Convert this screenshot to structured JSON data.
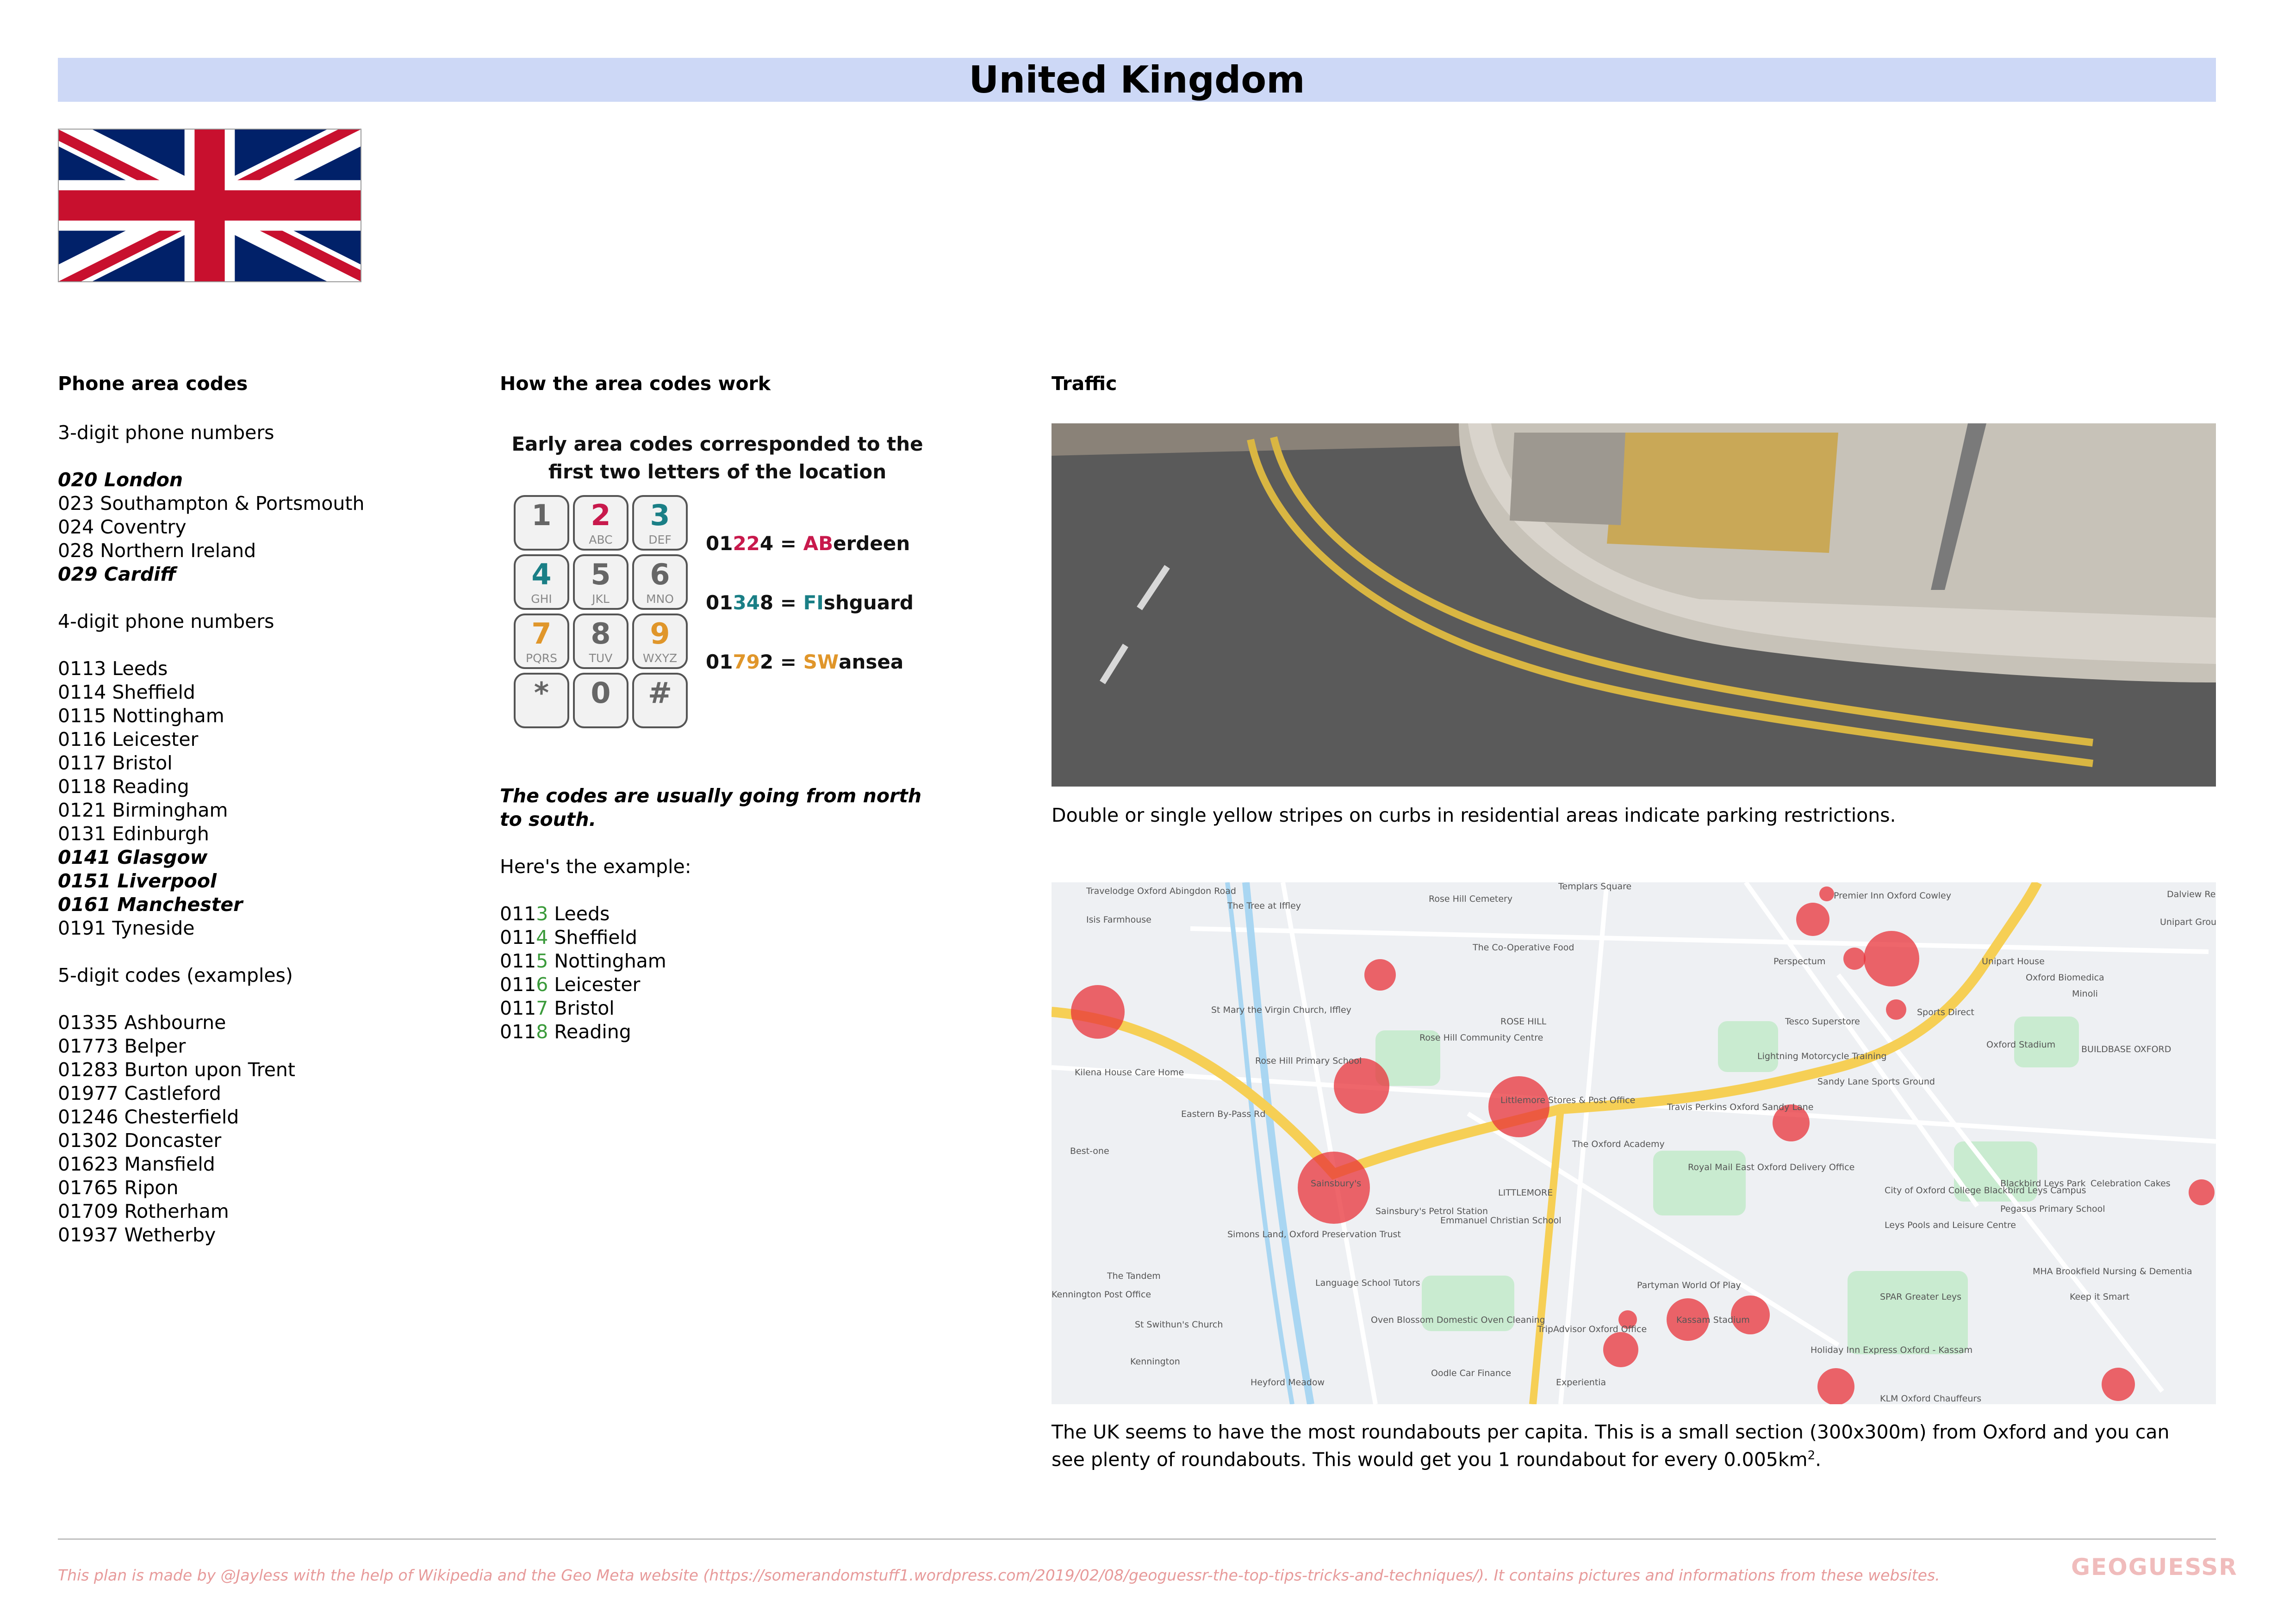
{
  "title": "United Kingdom",
  "phone": {
    "heading": "Phone area codes",
    "sub3": "3-digit phone numbers",
    "three_digit": [
      {
        "text": "020 London",
        "bold": true
      },
      {
        "text": "023 Southampton & Portsmouth",
        "bold": false
      },
      {
        "text": "024 Coventry",
        "bold": false
      },
      {
        "text": "028 Northern Ireland",
        "bold": false
      },
      {
        "text": "029 Cardiff",
        "bold": true
      }
    ],
    "sub4": "4-digit phone numbers",
    "four_digit": [
      {
        "text": "0113 Leeds",
        "bold": false
      },
      {
        "text": "0114 Sheffield",
        "bold": false
      },
      {
        "text": "0115 Nottingham",
        "bold": false
      },
      {
        "text": "0116 Leicester",
        "bold": false
      },
      {
        "text": "0117 Bristol",
        "bold": false
      },
      {
        "text": "0118 Reading",
        "bold": false
      },
      {
        "text": "0121 Birmingham",
        "bold": false
      },
      {
        "text": "0131 Edinburgh",
        "bold": false
      },
      {
        "text": "0141 Glasgow",
        "bold": true
      },
      {
        "text": "0151 Liverpool",
        "bold": true
      },
      {
        "text": "0161 Manchester",
        "bold": true
      },
      {
        "text": "0191 Tyneside",
        "bold": false
      }
    ],
    "sub5": "5-digit codes (examples)",
    "five_digit": [
      "01335 Ashbourne",
      "01773 Belper",
      "01283 Burton upon Trent",
      "01977 Castleford",
      "01246 Chesterfield",
      "01302 Doncaster",
      "01623 Mansfield",
      "01765 Ripon",
      "01709 Rotherham",
      "01937 Wetherby"
    ]
  },
  "howto": {
    "heading": "How the area codes work",
    "graphic_title_1": "Early area codes corresponded to the",
    "graphic_title_2": "first two letters of the location",
    "keys": [
      {
        "d": "1",
        "l": "",
        "color": "#666666"
      },
      {
        "d": "2",
        "l": "ABC",
        "color": "#c8194c"
      },
      {
        "d": "3",
        "l": "DEF",
        "color": "#1a7f86"
      },
      {
        "d": "4",
        "l": "GHI",
        "color": "#1a7f86"
      },
      {
        "d": "5",
        "l": "JKL",
        "color": "#666666"
      },
      {
        "d": "6",
        "l": "MNO",
        "color": "#666666"
      },
      {
        "d": "7",
        "l": "PQRS",
        "color": "#e0962a"
      },
      {
        "d": "8",
        "l": "TUV",
        "color": "#666666"
      },
      {
        "d": "9",
        "l": "WXYZ",
        "color": "#e0962a"
      },
      {
        "d": "*",
        "l": "",
        "color": "#666666"
      },
      {
        "d": "0",
        "l": "",
        "color": "#666666"
      },
      {
        "d": "#",
        "l": "",
        "color": "#666666"
      }
    ],
    "examples": [
      {
        "pre": "01",
        "hl": "22",
        "post": "4 = ",
        "hl2": "AB",
        "rest": "erdeen",
        "color": "#c8194c"
      },
      {
        "pre": "01",
        "hl": "34",
        "post": "8 = ",
        "hl2": "FI",
        "rest": "shguard",
        "color": "#1a7f86"
      },
      {
        "pre": "01",
        "hl": "79",
        "post": "2 = ",
        "hl2": "SW",
        "rest": "ansea",
        "color": "#e0962a"
      }
    ],
    "note": "The codes are usually going from north\nto south.",
    "example_intro": "Here's the example:",
    "example_list": [
      {
        "a": "011",
        "b": "3",
        "c": " Leeds"
      },
      {
        "a": "011",
        "b": "4",
        "c": " Sheffield"
      },
      {
        "a": "011",
        "b": "5",
        "c": " Nottingham"
      },
      {
        "a": "011",
        "b": "6",
        "c": " Leicester"
      },
      {
        "a": "011",
        "b": "7",
        "c": " Bristol"
      },
      {
        "a": "011",
        "b": "8",
        "c": " Reading"
      }
    ]
  },
  "traffic": {
    "heading": "Traffic",
    "caption1": "Double or single yellow stripes on curbs in residential areas indicate parking restrictions.",
    "caption2_line1": "The UK seems to have the most roundabouts per capita. This is a small section (300x300m) from Oxford and you can",
    "caption2_line2a": "see plenty of roundabouts. This would get you 1 roundabout for every 0.005km",
    "caption2_sup": "2",
    "caption2_line2b": ".",
    "map_labels": [
      "Travelodge Oxford Abingdon Road",
      "Isis Farmhouse",
      "The Tree at Iffley",
      "Rose Hill Cemetery",
      "Templars Square",
      "Premier Inn Oxford Cowley",
      "The Co-Operative Food",
      "Perspectum",
      "Unipart House",
      "Oxford Biomedica",
      "Minoli",
      "Sports Direct",
      "Tesco Superstore",
      "Oxford Stadium",
      "BUILDBASE OXFORD",
      "Rose Hill Community Centre",
      "Rose Hill Primary School",
      "St Mary the Virgin Church, Iffley",
      "Kilena House Care Home",
      "Lightning Motorcycle Training",
      "Sandy Lane Sports Ground",
      "Travis Perkins Oxford Sandy Lane",
      "Littlemore Stores & Post Office",
      "The Oxford Academy",
      "Eastern By-Pass Rd",
      "Best-one",
      "Sainsbury's",
      "Sainsbury's Petrol Station",
      "Emmanuel Christian School",
      "Royal Mail East Oxford Delivery Office",
      "City of Oxford College Blackbird Leys Campus",
      "Blackbird Leys Park",
      "Pegasus Primary School",
      "Leys Pools and Leisure Centre",
      "Celebration Cakes",
      "Simons Land, Oxford Preservation Trust",
      "The Tandem",
      "Language School Tutors",
      "Partyman World Of Play",
      "Oven Blossom Domestic Oven Cleaning",
      "TripAdvisor Oxford Office",
      "Kassam Stadium",
      "Holiday Inn Express Oxford - Kassam",
      "SPAR Greater Leys",
      "MHA Brookfield Nursing & Dementia",
      "Keep it Smart",
      "St Swithun's Church",
      "Kennington",
      "Heyford Meadow",
      "Oodle Car Finance",
      "Experientia",
      "KLM Oxford Chauffeurs",
      "Dalview Rec",
      "Unipart Group",
      "ROSE HILL",
      "LITTLEMORE",
      "Kennington Post Office"
    ]
  },
  "footer": {
    "text": "This plan is made by @Jayless with the help of Wikipedia and the Geo Meta website (https://somerandomstuff1.wordpress.com/2019/02/08/geoguessr-the-top-tips-tricks-and-techniques/). It contains pictures and informations from these websites.",
    "logo": "GEOGUESSR"
  },
  "colors": {
    "title_band": "#cdd8f6",
    "flag_blue": "#012169",
    "flag_red": "#C8102E",
    "roundabout_marker": "#e8333a",
    "footer_text": "#e79a9a"
  }
}
